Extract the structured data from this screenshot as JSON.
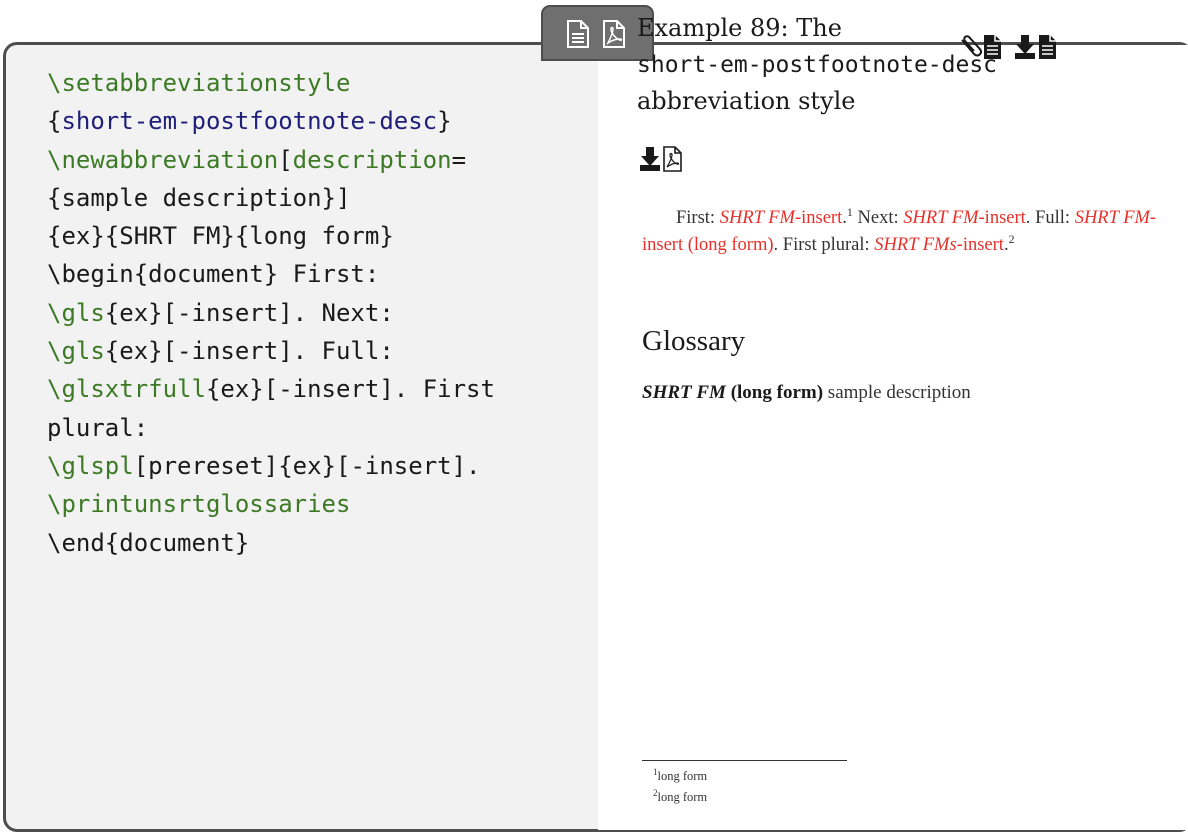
{
  "example": {
    "title_prefix": "Example 89: The",
    "title_style": "short-em-postfootnote-desc",
    "title_suffix": "abbreviation style"
  },
  "icons": {
    "tab": [
      "document-icon",
      "pdf-icon"
    ],
    "top_right": [
      "paperclip-document-icon",
      "download-document-icon"
    ],
    "title": "download-pdf-icon"
  },
  "code": {
    "line1": "\\setabbreviationstyle",
    "line2_open": "{",
    "line2_arg": "short-em-postfootnote-desc",
    "line2_close": "}",
    "line3_cmd": "\\newabbreviation",
    "line3_bracket": "[",
    "line3_key": "description",
    "line3_eq": "=",
    "line4": "{sample description}]",
    "line5": "{ex}{SHRT FM}{long form}",
    "line6": "\\begin{document} First:",
    "line7_cmd": "\\gls",
    "line7_rest": "{ex}[-insert]. Next:",
    "line8_cmd": "\\gls",
    "line8_rest": "{ex}[-insert]. Full:",
    "line9_cmd": "\\glsxtrfull",
    "line9_rest": "{ex}[-insert]. First",
    "line10": "plural:",
    "line11_cmd": "\\glspl",
    "line11_rest": "[prereset]{ex}[-insert].",
    "line12": "\\printunsrtglossaries",
    "line13": "\\end{document}"
  },
  "output": {
    "first_label": "First:",
    "first_abbr": "SHRT FM",
    "first_insert": "-insert",
    "first_fn": "1",
    "next_label": "Next:",
    "next_abbr": "SHRT FM",
    "next_insert": "-insert",
    "full_label": "Full:",
    "full_abbr": "SHRT FM",
    "full_insert": "-insert (long form)",
    "plural_label": "First plural:",
    "plural_abbr": "SHRT FMs",
    "plural_insert": "-insert",
    "plural_fn": "2"
  },
  "glossary": {
    "heading": "Glossary",
    "term": "SHRT FM",
    "long": "(long form)",
    "description": "sample description"
  },
  "footnotes": [
    {
      "mark": "1",
      "text": "long form"
    },
    {
      "mark": "2",
      "text": "long form"
    }
  ],
  "colors": {
    "command": "#3d7a26",
    "argument": "#1f1f7a",
    "link": "#e8302a",
    "code_bg": "#f2f2f2",
    "frame": "#4d4d4d"
  }
}
